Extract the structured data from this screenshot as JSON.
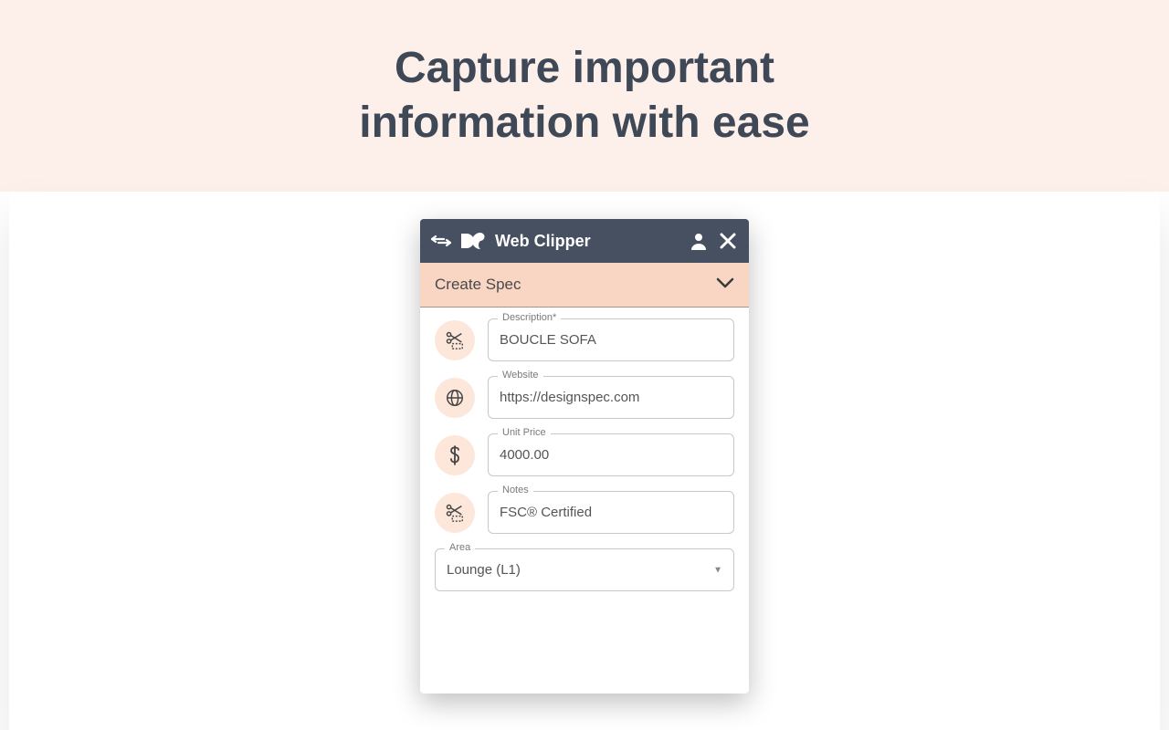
{
  "hero": {
    "headline_line1": "Capture important",
    "headline_line2": "information with ease"
  },
  "widget": {
    "title": "Web Clipper",
    "section_title": "Create Spec",
    "fields": {
      "description": {
        "label": "Description*",
        "value": "BOUCLE SOFA"
      },
      "website": {
        "label": "Website",
        "value": "https://designspec.com"
      },
      "unit_price": {
        "label": "Unit Price",
        "value": "4000.00"
      },
      "notes": {
        "label": "Notes",
        "value": "FSC® Certified"
      },
      "area": {
        "label": "Area",
        "value": "Lounge (L1)"
      }
    }
  }
}
